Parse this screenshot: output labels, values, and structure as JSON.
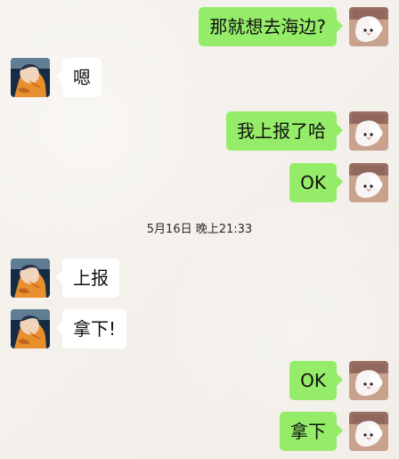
{
  "chat": {
    "timestamp": "5月16日 晚上21:33",
    "messages": [
      {
        "sender": "self",
        "text": "那就想去海边?"
      },
      {
        "sender": "peer",
        "text": "嗯"
      },
      {
        "sender": "self",
        "text": "我上报了哈"
      },
      {
        "sender": "self",
        "text": "OK"
      },
      {
        "sender": "peer",
        "text": "上报"
      },
      {
        "sender": "peer",
        "text": "拿下!"
      },
      {
        "sender": "self",
        "text": "OK"
      },
      {
        "sender": "self",
        "text": "拿下"
      }
    ]
  },
  "icons": {
    "self_avatar": "cat-avatar-icon",
    "peer_avatar": "anime-avatar-icon"
  },
  "colors": {
    "background": "#f4f0ec",
    "self_bubble": "#95ec69",
    "peer_bubble": "#ffffff"
  }
}
